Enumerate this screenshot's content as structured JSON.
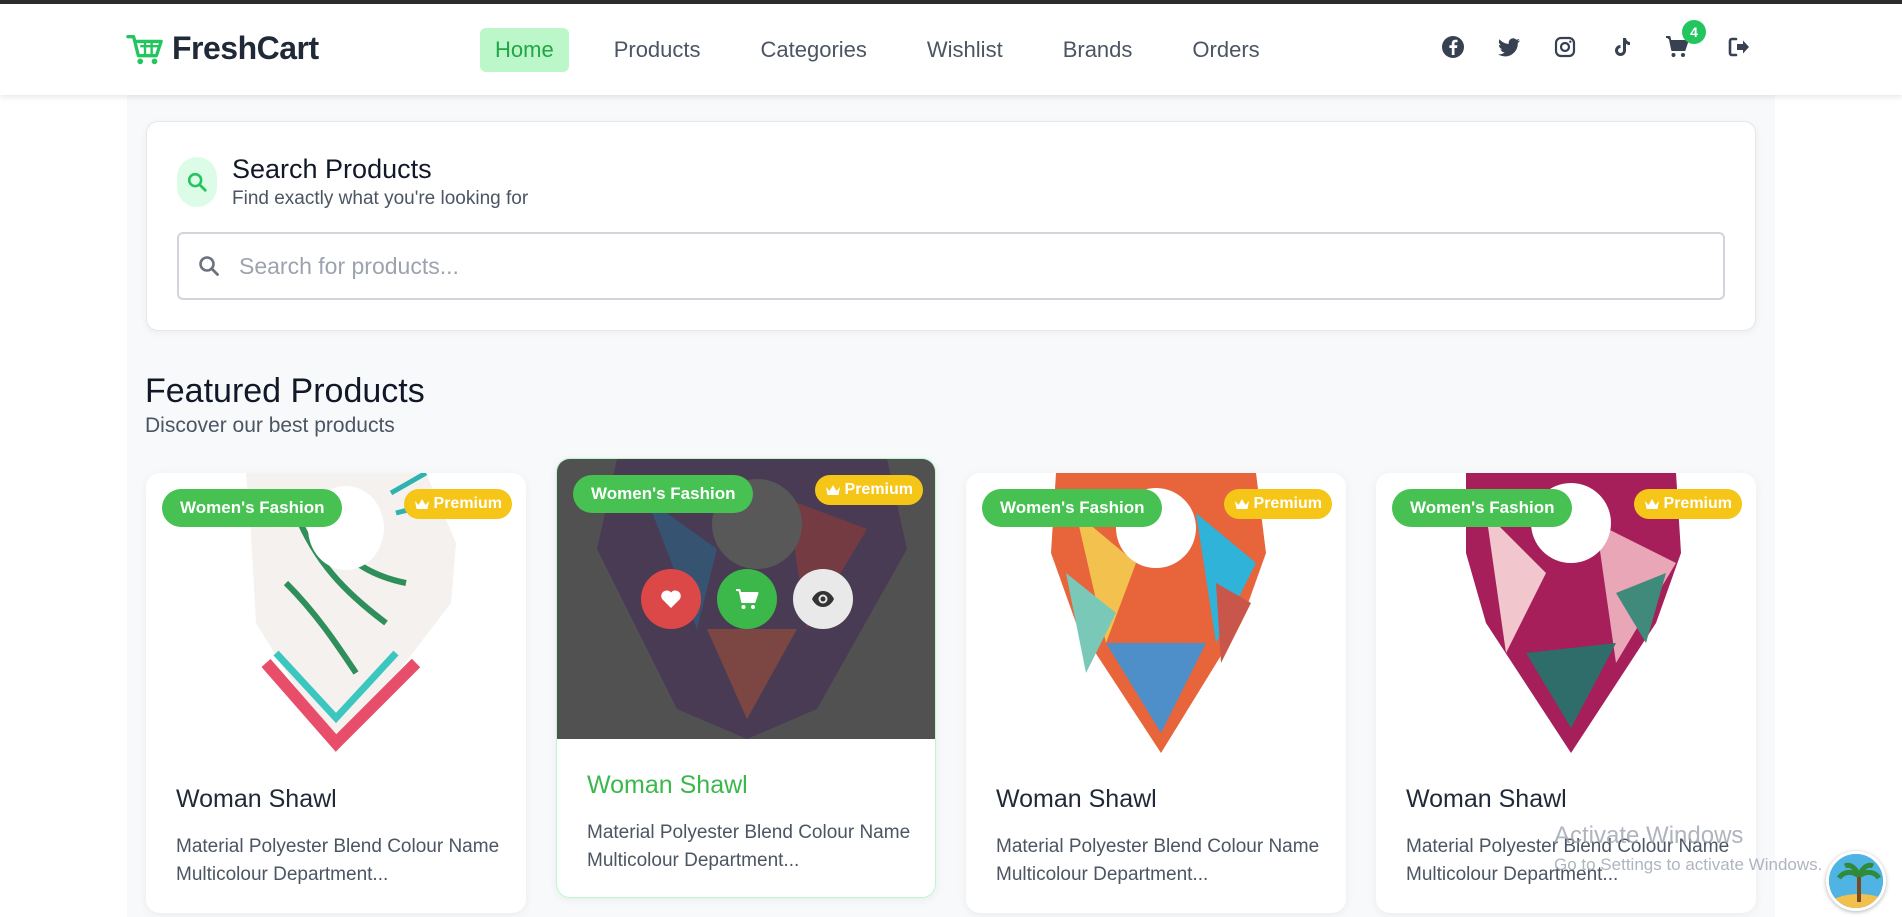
{
  "brand": {
    "name": "FreshCart"
  },
  "nav": {
    "links": [
      {
        "label": "Home",
        "active": true
      },
      {
        "label": "Products",
        "active": false
      },
      {
        "label": "Categories",
        "active": false
      },
      {
        "label": "Wishlist",
        "active": false
      },
      {
        "label": "Brands",
        "active": false
      },
      {
        "label": "Orders",
        "active": false
      }
    ],
    "social_icons": [
      "facebook-icon",
      "twitter-icon",
      "instagram-icon",
      "tiktok-icon"
    ],
    "cart_count": "4"
  },
  "search": {
    "title": "Search Products",
    "subtitle": "Find exactly what you're looking for",
    "placeholder": "Search for products..."
  },
  "featured": {
    "title": "Featured Products",
    "subtitle": "Discover our best products",
    "products": [
      {
        "category": "Women's Fashion",
        "badge": "Premium",
        "title": "Woman Shawl",
        "description": "Material Polyester Blend Colour Name Multicolour Department..."
      },
      {
        "category": "Women's Fashion",
        "badge": "Premium",
        "title": "Woman Shawl",
        "description": "Material Polyester Blend Colour Name Multicolour Department..."
      },
      {
        "category": "Women's Fashion",
        "badge": "Premium",
        "title": "Woman Shawl",
        "description": "Material Polyester Blend Colour Name Multicolour Department..."
      },
      {
        "category": "Women's Fashion",
        "badge": "Premium",
        "title": "Woman Shawl",
        "description": "Material Polyester Blend Colour Name Multicolour Department..."
      }
    ]
  },
  "os_overlay": {
    "activate_title": "Activate Windows",
    "activate_sub": "Go to Settings to activate Windows."
  },
  "colors": {
    "accent": "#22c55e",
    "premium": "#f5c518",
    "wishlist": "#dc4848"
  }
}
